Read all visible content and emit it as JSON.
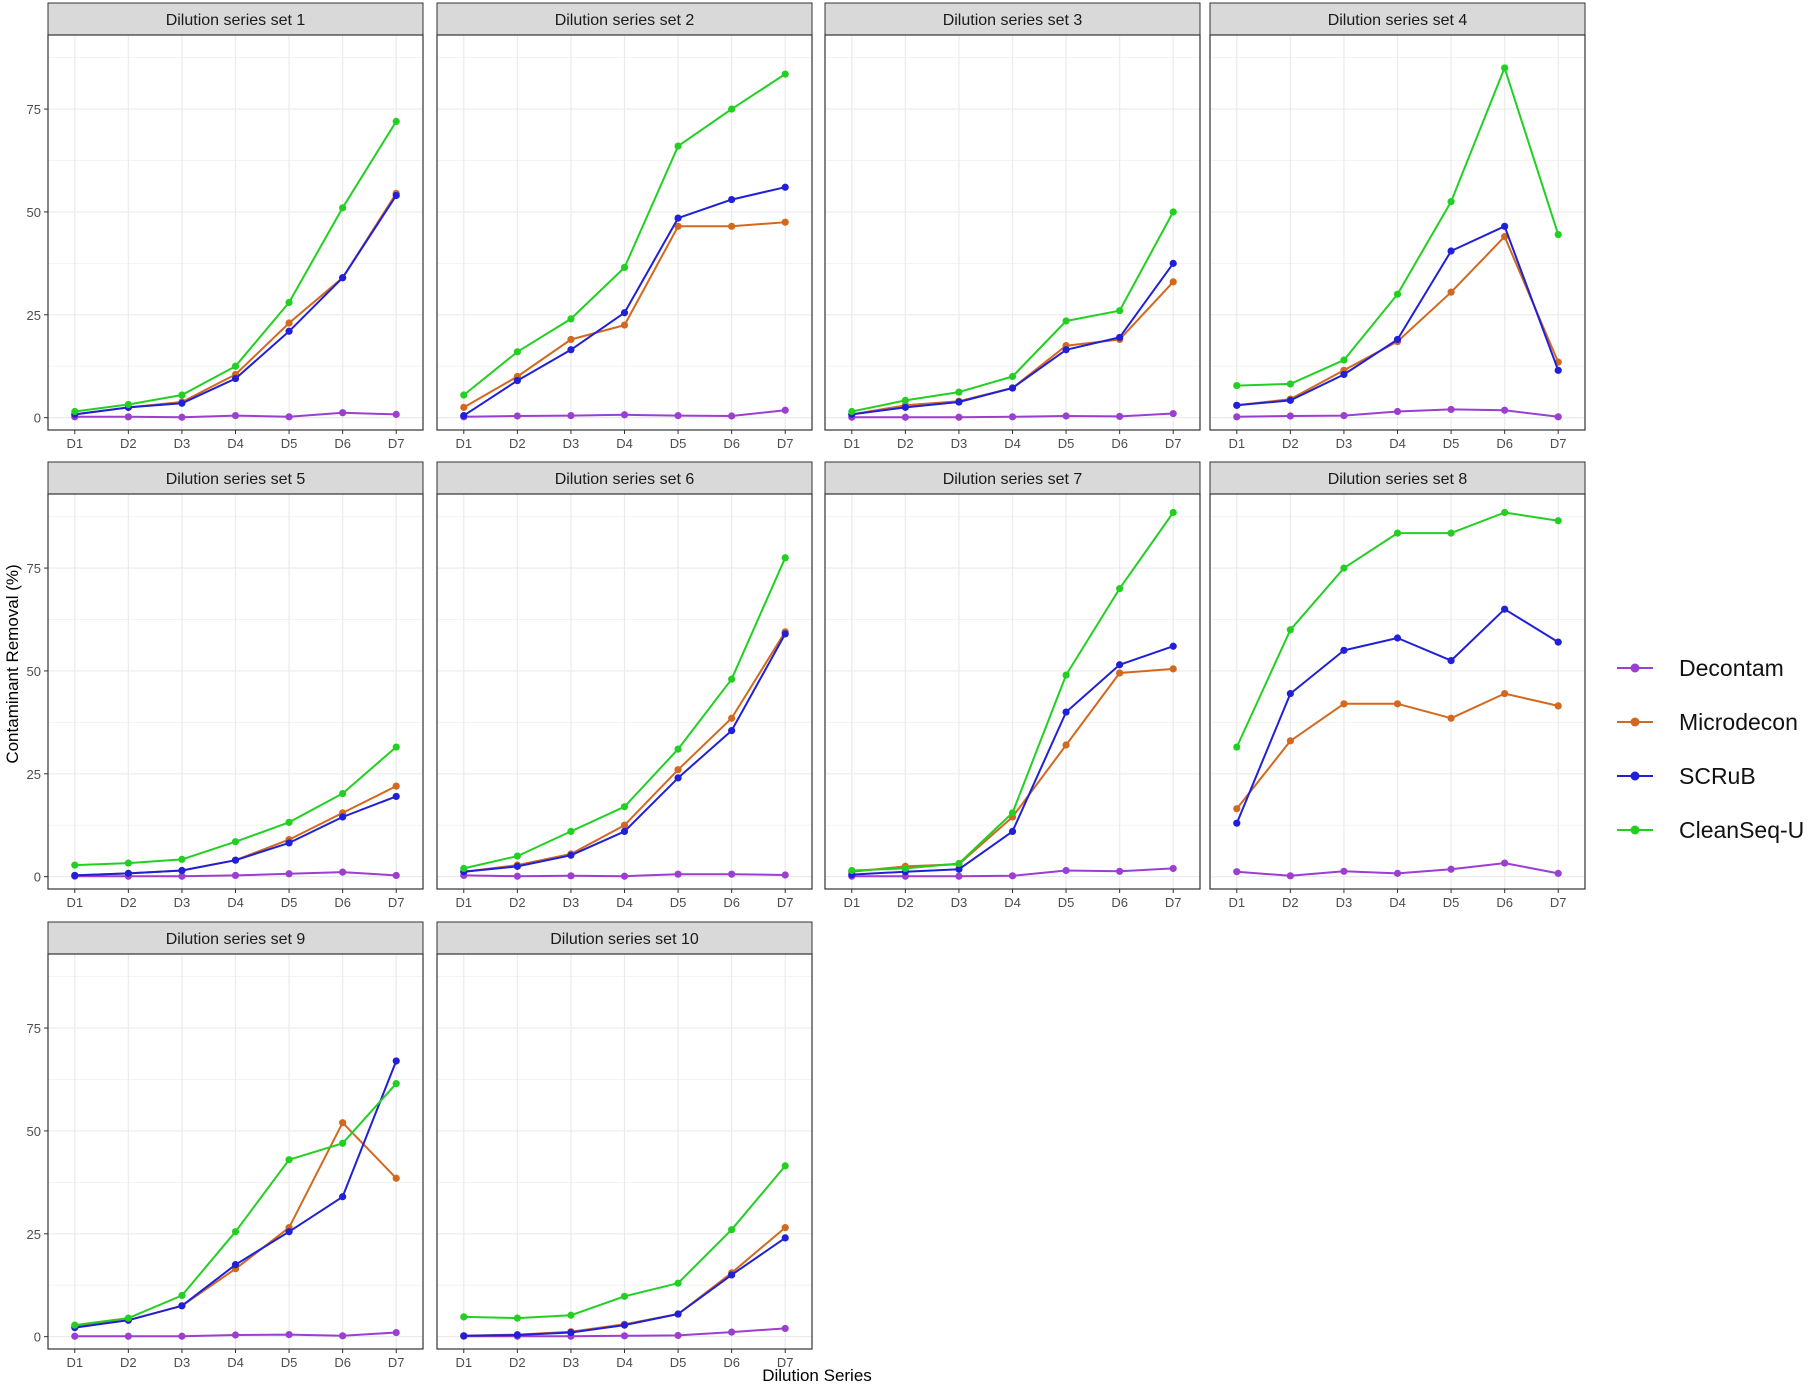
{
  "figure": {
    "ylabel": "Contaminant Removal (%)",
    "xlabel": "Dilution Series"
  },
  "legend": {
    "placement": "right",
    "items": [
      "Decontam",
      "Microdecon",
      "SCRuB",
      "CleanSeq-U"
    ]
  },
  "colors": {
    "Decontam": "#9B3FD1",
    "Microdecon": "#D2691E",
    "SCRuB": "#2020D8",
    "CleanSeq-U": "#22D022",
    "strip_bg": "#D9D9D9",
    "grid": "#EBEBEB",
    "panel_border": "#333333"
  },
  "chart_data": {
    "type": "line",
    "facet": true,
    "grid": true,
    "xlabel": "Dilution Series",
    "ylabel": "Contaminant Removal (%)",
    "x": [
      "D1",
      "D2",
      "D3",
      "D4",
      "D5",
      "D6",
      "D7"
    ],
    "ylim": [
      -3,
      93
    ],
    "yticks": [
      0,
      25,
      50,
      75
    ],
    "series_names": [
      "Decontam",
      "Microdecon",
      "SCRuB",
      "CleanSeq-U"
    ],
    "panels": [
      {
        "title": "Dilution series set 1",
        "series": [
          {
            "name": "Decontam",
            "values": [
              0.2,
              0.2,
              0.1,
              0.5,
              0.2,
              1.2,
              0.8
            ]
          },
          {
            "name": "Microdecon",
            "values": [
              0.8,
              2.5,
              3.8,
              10.5,
              23,
              34,
              54.5
            ]
          },
          {
            "name": "SCRuB",
            "values": [
              0.8,
              2.5,
              3.5,
              9.5,
              21,
              34,
              54
            ]
          },
          {
            "name": "CleanSeq-U",
            "values": [
              1.5,
              3.2,
              5.5,
              12.5,
              28,
              51,
              72
            ]
          }
        ]
      },
      {
        "title": "Dilution series set 2",
        "series": [
          {
            "name": "Decontam",
            "values": [
              0.2,
              0.4,
              0.5,
              0.7,
              0.5,
              0.4,
              1.8
            ]
          },
          {
            "name": "Microdecon",
            "values": [
              2.5,
              10,
              19,
              22.5,
              46.5,
              46.5,
              47.5
            ]
          },
          {
            "name": "SCRuB",
            "values": [
              0.5,
              9,
              16.5,
              25.5,
              48.5,
              53,
              56
            ]
          },
          {
            "name": "CleanSeq-U",
            "values": [
              5.5,
              16,
              24,
              36.5,
              66,
              75,
              83.5
            ]
          }
        ]
      },
      {
        "title": "Dilution series set 3",
        "series": [
          {
            "name": "Decontam",
            "values": [
              0.1,
              0.1,
              0.1,
              0.2,
              0.4,
              0.3,
              1.0
            ]
          },
          {
            "name": "Microdecon",
            "values": [
              0.8,
              3.0,
              4.0,
              7.2,
              17.5,
              19,
              33
            ]
          },
          {
            "name": "SCRuB",
            "values": [
              0.8,
              2.5,
              3.8,
              7.2,
              16.5,
              19.5,
              37.5
            ]
          },
          {
            "name": "CleanSeq-U",
            "values": [
              1.5,
              4.2,
              6.2,
              10,
              23.5,
              26,
              50
            ]
          }
        ]
      },
      {
        "title": "Dilution series set 4",
        "series": [
          {
            "name": "Decontam",
            "values": [
              0.2,
              0.4,
              0.5,
              1.5,
              2.0,
              1.8,
              0.2
            ]
          },
          {
            "name": "Microdecon",
            "values": [
              3.0,
              4.5,
              11.5,
              18.5,
              30.5,
              44,
              13.5
            ]
          },
          {
            "name": "SCRuB",
            "values": [
              3.0,
              4.2,
              10.5,
              19,
              40.5,
              46.5,
              11.5
            ]
          },
          {
            "name": "CleanSeq-U",
            "values": [
              7.8,
              8.2,
              14,
              30,
              52.5,
              85,
              44.5
            ]
          }
        ]
      },
      {
        "title": "Dilution series set 5",
        "series": [
          {
            "name": "Decontam",
            "values": [
              0.1,
              0.1,
              0.1,
              0.3,
              0.7,
              1.1,
              0.3
            ]
          },
          {
            "name": "Microdecon",
            "values": [
              0.3,
              0.8,
              1.5,
              4.0,
              9.0,
              15.5,
              22
            ]
          },
          {
            "name": "SCRuB",
            "values": [
              0.3,
              0.8,
              1.5,
              4.0,
              8.2,
              14.5,
              19.5
            ]
          },
          {
            "name": "CleanSeq-U",
            "values": [
              2.8,
              3.3,
              4.2,
              8.5,
              13.2,
              20.2,
              31.5
            ]
          }
        ]
      },
      {
        "title": "Dilution series set 6",
        "series": [
          {
            "name": "Decontam",
            "values": [
              0.3,
              0.1,
              0.2,
              0.1,
              0.6,
              0.6,
              0.4
            ]
          },
          {
            "name": "Microdecon",
            "values": [
              1.2,
              2.8,
              5.5,
              12.5,
              26,
              38.5,
              59.5
            ]
          },
          {
            "name": "SCRuB",
            "values": [
              1.2,
              2.5,
              5.2,
              11,
              24,
              35.5,
              59
            ]
          },
          {
            "name": "CleanSeq-U",
            "values": [
              2.0,
              5.0,
              11,
              17,
              31,
              48,
              77.5
            ]
          }
        ]
      },
      {
        "title": "Dilution series set 7",
        "series": [
          {
            "name": "Decontam",
            "values": [
              0.1,
              0.1,
              0.1,
              0.2,
              1.5,
              1.3,
              2.0
            ]
          },
          {
            "name": "Microdecon",
            "values": [
              1.2,
              2.5,
              3.0,
              14.5,
              32,
              49.5,
              50.5
            ]
          },
          {
            "name": "SCRuB",
            "values": [
              0.5,
              1.2,
              1.8,
              11,
              40,
              51.5,
              56
            ]
          },
          {
            "name": "CleanSeq-U",
            "values": [
              1.5,
              2.0,
              3.2,
              15.5,
              49,
              70,
              88.5
            ]
          }
        ]
      },
      {
        "title": "Dilution series set 8",
        "series": [
          {
            "name": "Decontam",
            "values": [
              1.2,
              0.2,
              1.3,
              0.8,
              1.8,
              3.3,
              0.8
            ]
          },
          {
            "name": "Microdecon",
            "values": [
              16.5,
              33,
              42,
              42,
              38.5,
              44.5,
              41.5
            ]
          },
          {
            "name": "SCRuB",
            "values": [
              13,
              44.5,
              55,
              58,
              52.5,
              65,
              57
            ]
          },
          {
            "name": "CleanSeq-U",
            "values": [
              31.5,
              60,
              75,
              83.5,
              83.5,
              88.5,
              86.5
            ]
          }
        ]
      },
      {
        "title": "Dilution series set 9",
        "series": [
          {
            "name": "Decontam",
            "values": [
              0.1,
              0.1,
              0.1,
              0.4,
              0.5,
              0.2,
              1.0
            ]
          },
          {
            "name": "Microdecon",
            "values": [
              2.5,
              4.0,
              7.5,
              16.5,
              26.5,
              52,
              38.5
            ]
          },
          {
            "name": "SCRuB",
            "values": [
              2.2,
              4.0,
              7.5,
              17.5,
              25.5,
              34,
              67
            ]
          },
          {
            "name": "CleanSeq-U",
            "values": [
              2.8,
              4.5,
              10,
              25.5,
              43,
              47,
              61.5
            ]
          }
        ]
      },
      {
        "title": "Dilution series set 10",
        "series": [
          {
            "name": "Decontam",
            "values": [
              0.1,
              0.1,
              0.1,
              0.2,
              0.3,
              1.1,
              2.0
            ]
          },
          {
            "name": "Microdecon",
            "values": [
              0.2,
              0.5,
              1.2,
              3.0,
              5.5,
              15.5,
              26.5
            ]
          },
          {
            "name": "SCRuB",
            "values": [
              0.2,
              0.4,
              1.0,
              2.8,
              5.5,
              15,
              24
            ]
          },
          {
            "name": "CleanSeq-U",
            "values": [
              4.8,
              4.5,
              5.2,
              9.8,
              13,
              26,
              41.5
            ]
          }
        ]
      }
    ]
  }
}
